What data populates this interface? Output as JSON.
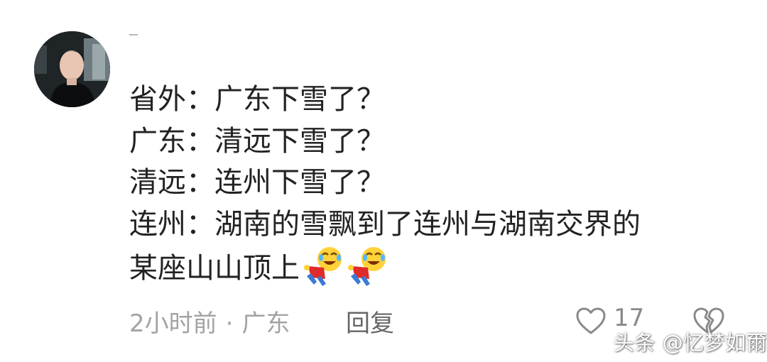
{
  "comment": {
    "lines": [
      "省外：广东下雪了？",
      "广东：清远下雪了？",
      "清远：连州下雪了？",
      "连州：湖南的雪飘到了连州与湖南交界的",
      "某座山山顶上"
    ],
    "emoji_names": [
      "bowing-laughing-emoji",
      "bowing-laughing-emoji"
    ]
  },
  "meta": {
    "time": "2小时前",
    "separator": "·",
    "location": "广东",
    "reply_label": "回复"
  },
  "actions": {
    "like_icon": "heart-outline-icon",
    "like_count": "17",
    "dislike_icon": "broken-heart-icon"
  },
  "watermark": "头条 @忆梦如爾",
  "colors": {
    "comment_text": "#222222",
    "meta_text": "#a3a3a3",
    "reply_text": "#666666",
    "icon_stroke": "#8a8a8a",
    "background": "#ffffff"
  }
}
